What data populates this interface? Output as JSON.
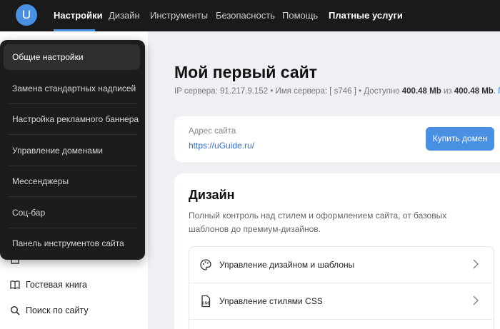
{
  "topbar": {
    "logo_letter": "U",
    "nav": [
      {
        "label": "Настройки",
        "active": true
      },
      {
        "label": "Дизайн"
      },
      {
        "label": "Инструменты"
      },
      {
        "label": "Безопасность"
      },
      {
        "label": "Помощь"
      },
      {
        "label": "Платные услуги",
        "bold": true
      }
    ]
  },
  "dropdown": {
    "items": [
      {
        "label": "Общие настройки",
        "active": true
      },
      {
        "label": "Замена стандартных надписей"
      },
      {
        "label": "Настройка рекламного баннера"
      },
      {
        "label": "Управление доменами"
      },
      {
        "label": "Мессенджеры"
      },
      {
        "label": "Соц-бар"
      },
      {
        "label": "Панель инструментов сайта"
      }
    ]
  },
  "sidebar": {
    "items": [
      {
        "label": "Гостевая книга",
        "icon": "book-icon"
      },
      {
        "label": "Поиск по сайту",
        "icon": "search-icon"
      }
    ]
  },
  "main": {
    "title": "Мой первый сайт",
    "server": {
      "ip_label": "IP сервера:",
      "ip": "91.217.9.152",
      "name_label": "• Имя сервера: [ s746 ] • Доступно",
      "available": "400.48 Mb",
      "of": "из",
      "total": "400.48 Mb",
      "more": ". Под"
    },
    "address": {
      "label": "Адрес сайта",
      "url": "https://uGuide.ru/",
      "buy_label": "Купить домен"
    },
    "design": {
      "title": "Дизайн",
      "description": "Полный контроль над стилем и оформлением сайта, от базовых шаблонов до премиум-дизайнов.",
      "items": [
        {
          "label": "Управление дизайном и шаблоны",
          "icon": "palette-icon"
        },
        {
          "label": "Управление стилями CSS",
          "icon": "css-file-icon"
        }
      ]
    }
  },
  "colors": {
    "accent": "#4a90e2",
    "topbar_bg": "#1a1a1a",
    "dropdown_bg": "#1c1c1c",
    "page_bg": "#eef0f3"
  }
}
